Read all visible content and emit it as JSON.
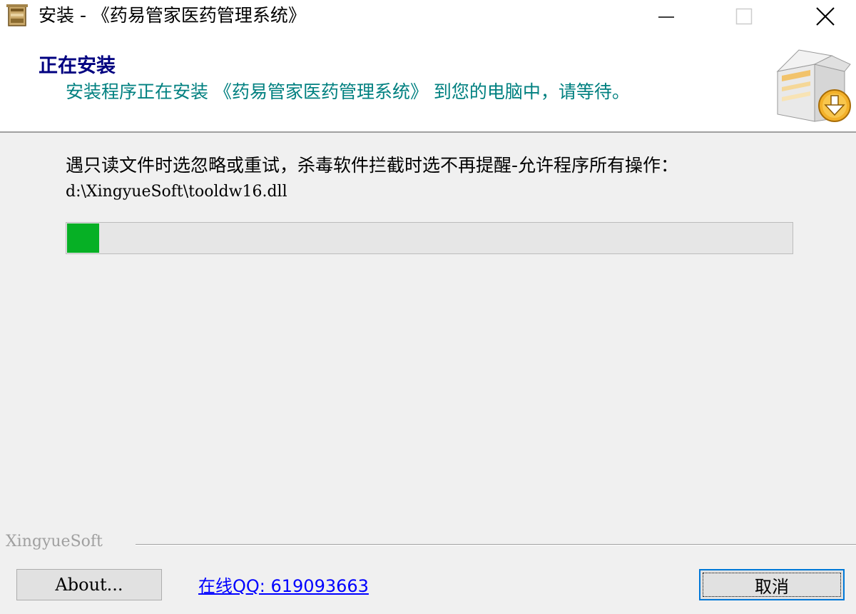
{
  "window": {
    "title": "安装 - 《药易管家医药管理系统》",
    "controls": {
      "minimize_icon": "minimize-icon",
      "maximize_icon": "maximize-icon",
      "close_icon": "close-icon"
    }
  },
  "header": {
    "title": "正在安装",
    "subtitle": "安装程序正在安装 《药易管家医药管理系统》 到您的电脑中，请等待。",
    "title_color": "#000080",
    "subtitle_color": "#008080",
    "icon": "install-box-icon"
  },
  "body": {
    "status_text": "遇只读文件时选忽略或重试，杀毒软件拦截时选不再提醒-允许程序所有操作：",
    "current_file": "d:\\XingyueSoft\\tooldw16.dll",
    "progress": 0.044,
    "progress_color": "#06b025"
  },
  "footer": {
    "brand": "XingyueSoft",
    "about_label": "About...",
    "online_link": "在线QQ: 619093663",
    "cancel_label": "取消"
  }
}
